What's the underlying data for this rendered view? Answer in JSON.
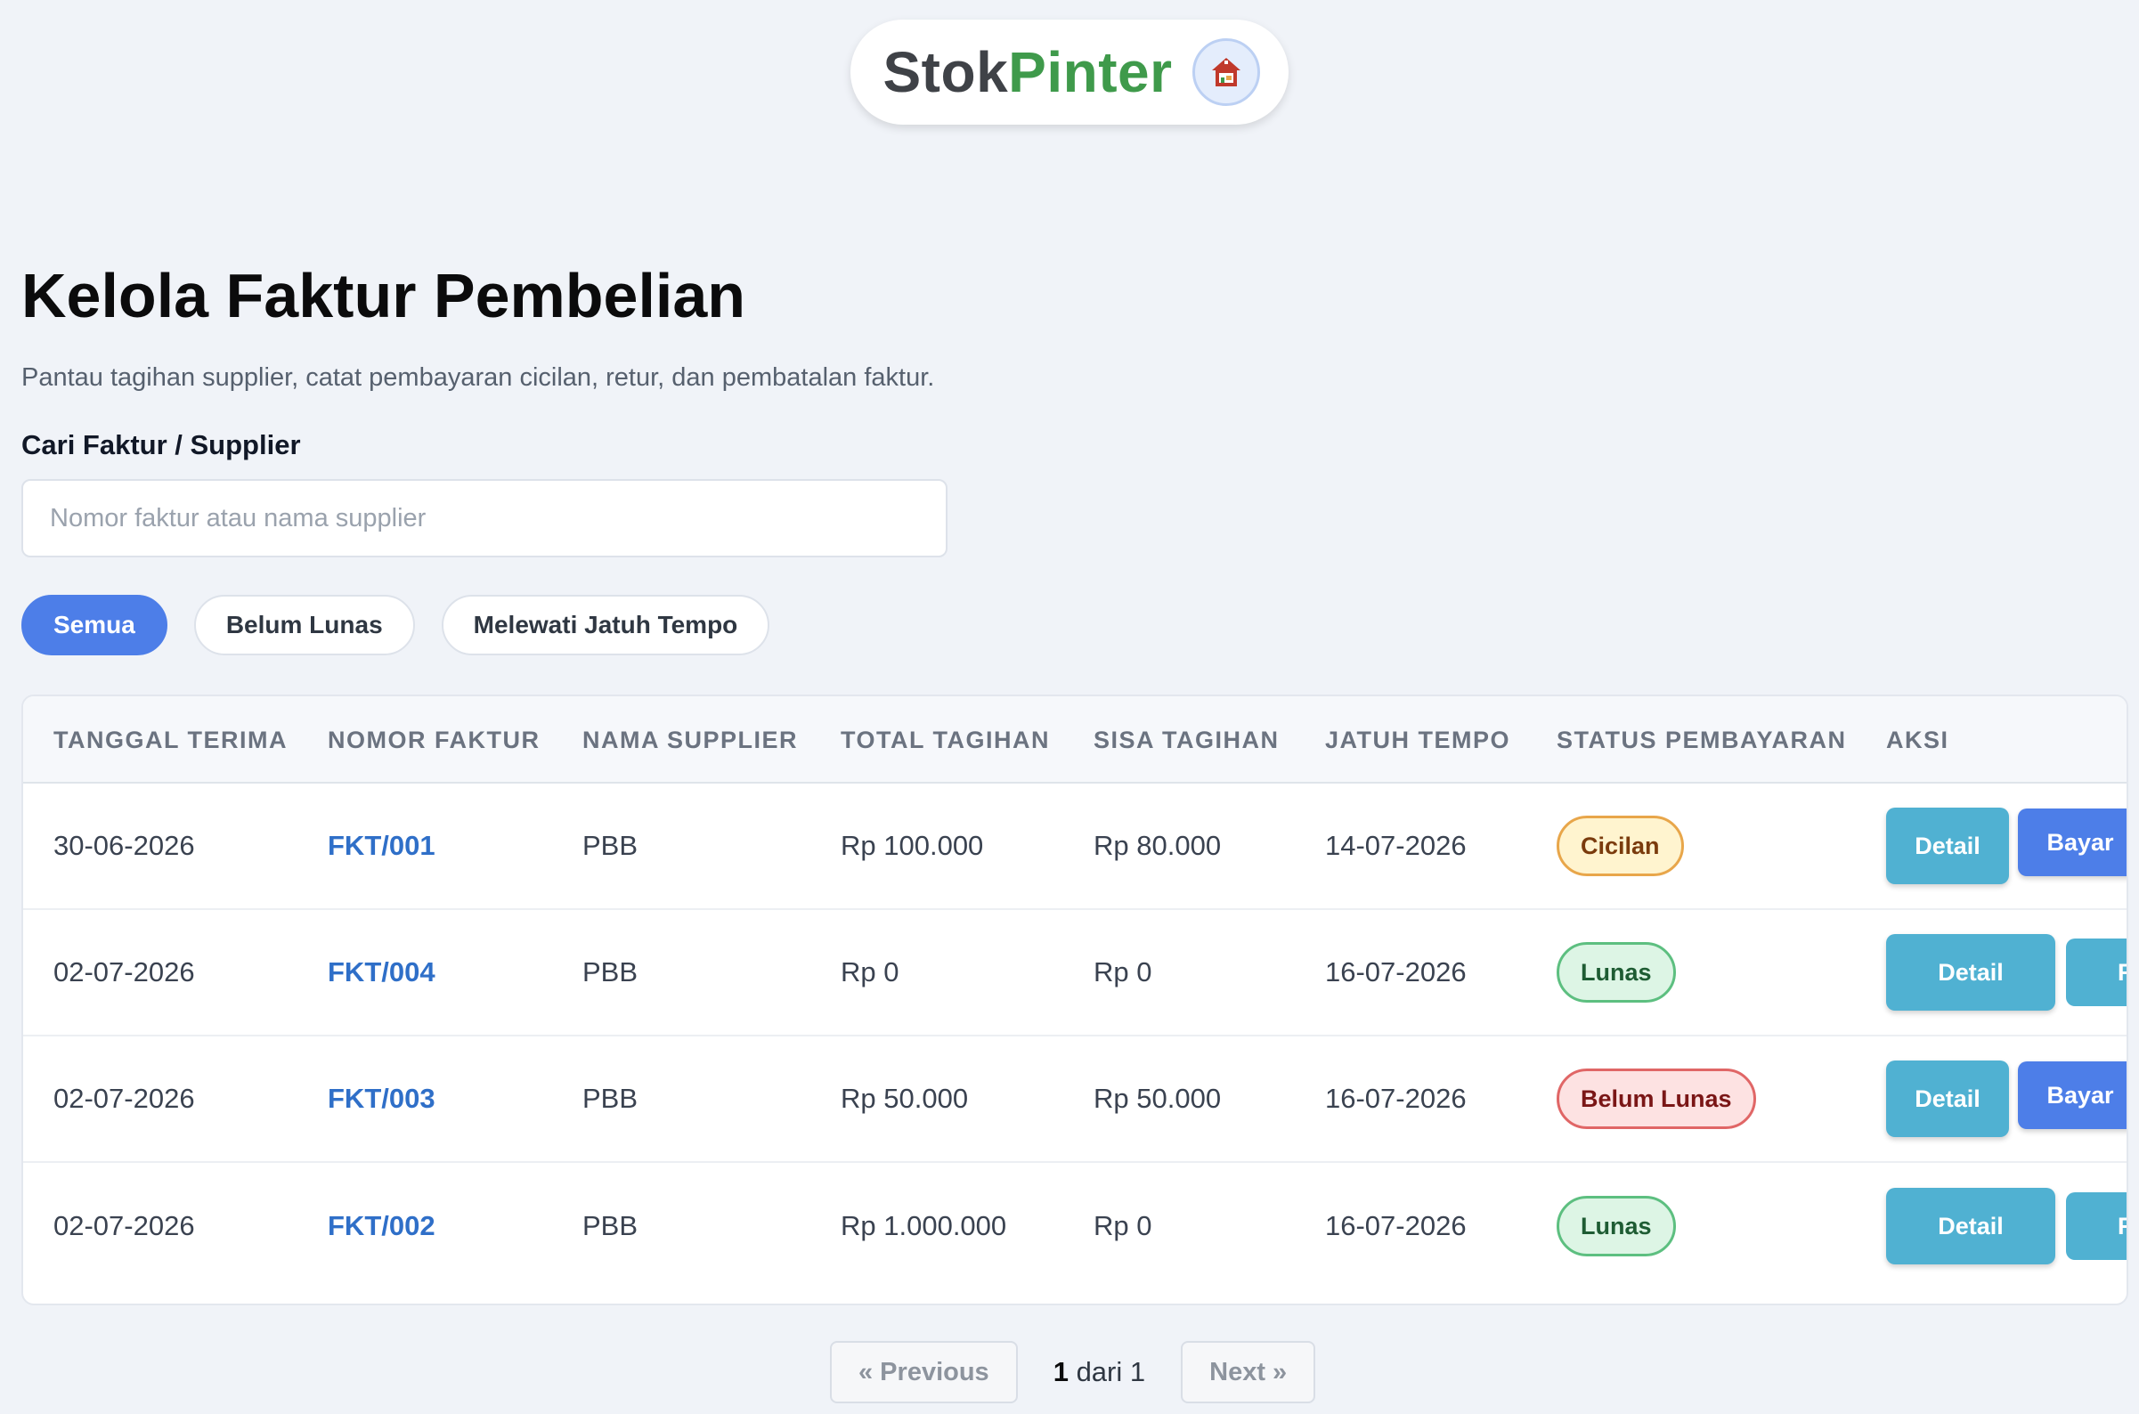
{
  "brand": {
    "name_part1": "Stok",
    "name_part2": "Pinter",
    "logo_icon": "house-shop-icon"
  },
  "page": {
    "title": "Kelola Faktur Pembelian",
    "subtitle": "Pantau tagihan supplier, catat pembayaran cicilan, retur, dan pembatalan faktur."
  },
  "search": {
    "label": "Cari Faktur / Supplier",
    "placeholder": "Nomor faktur atau nama supplier",
    "value": ""
  },
  "filters": [
    {
      "label": "Semua",
      "active": true
    },
    {
      "label": "Belum Lunas",
      "active": false
    },
    {
      "label": "Melewati Jatuh Tempo",
      "active": false
    }
  ],
  "table": {
    "columns": [
      "TANGGAL TERIMA",
      "NOMOR FAKTUR",
      "NAMA SUPPLIER",
      "TOTAL TAGIHAN",
      "SISA TAGIHAN",
      "JATUH TEMPO",
      "STATUS PEMBAYARAN",
      "AKSI"
    ],
    "rows": [
      {
        "tanggal": "30-06-2026",
        "nomor": "FKT/001",
        "supplier": "PBB",
        "total": "Rp 100.000",
        "sisa": "Rp 80.000",
        "jatuh_tempo": "14-07-2026",
        "status": "Cicilan",
        "detail": "Detail",
        "bayar": "Bayar"
      },
      {
        "tanggal": "02-07-2026",
        "nomor": "FKT/004",
        "supplier": "PBB",
        "total": "Rp 0",
        "sisa": "Rp 0",
        "jatuh_tempo": "16-07-2026",
        "status": "Lunas",
        "detail": "Detail",
        "cut_button": "R"
      },
      {
        "tanggal": "02-07-2026",
        "nomor": "FKT/003",
        "supplier": "PBB",
        "total": "Rp 50.000",
        "sisa": "Rp 50.000",
        "jatuh_tempo": "16-07-2026",
        "status": "Belum Lunas",
        "detail": "Detail",
        "bayar": "Bayar"
      },
      {
        "tanggal": "02-07-2026",
        "nomor": "FKT/002",
        "supplier": "PBB",
        "total": "Rp 1.000.000",
        "sisa": "Rp 0",
        "jatuh_tempo": "16-07-2026",
        "status": "Lunas",
        "detail": "Detail",
        "cut_button": "R"
      }
    ]
  },
  "pagination": {
    "previous": "« Previous",
    "next": "Next »",
    "current": "1",
    "of_label": "dari",
    "total": "1"
  },
  "colors": {
    "accent": "#4d7ee8",
    "detail_button": "#50b1d2",
    "link": "#2f6fc8",
    "brand_green": "#3f9a4b"
  }
}
